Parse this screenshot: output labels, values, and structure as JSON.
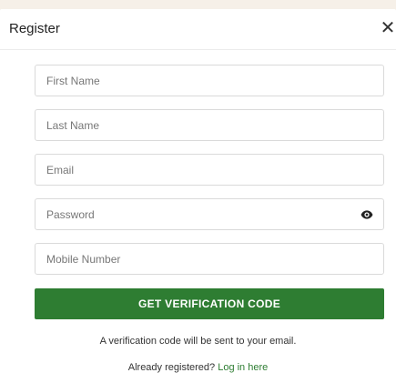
{
  "modal": {
    "title": "Register",
    "close_icon": "close-icon"
  },
  "form": {
    "first_name": {
      "placeholder": "First Name",
      "value": ""
    },
    "last_name": {
      "placeholder": "Last Name",
      "value": ""
    },
    "email": {
      "placeholder": "Email",
      "value": ""
    },
    "password": {
      "placeholder": "Password",
      "value": "",
      "toggle_icon": "eye-icon"
    },
    "mobile": {
      "placeholder": "Mobile Number",
      "value": ""
    },
    "submit_label": "GET VERIFICATION CODE"
  },
  "notes": {
    "verification": "A verification code will be sent to your email.",
    "already_registered": "Already registered?",
    "login_link": "Log in here"
  },
  "colors": {
    "primary": "#2e7d32",
    "page_background": "#f6f0e8"
  }
}
